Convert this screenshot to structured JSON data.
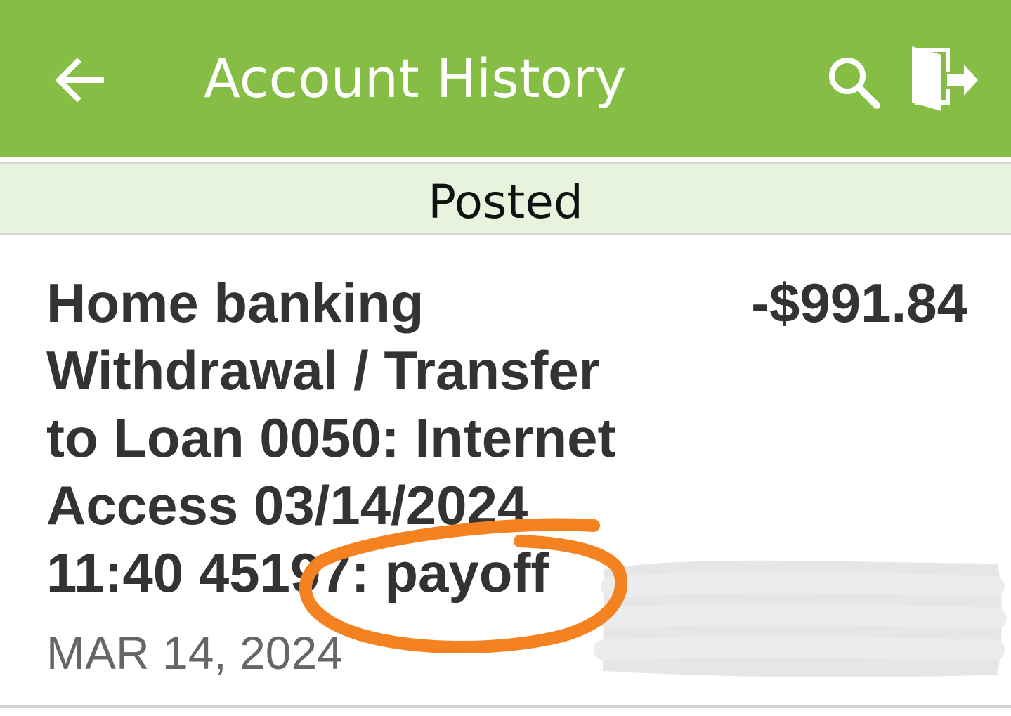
{
  "header": {
    "title": "Account History",
    "back_icon": "arrow-left-icon",
    "search_icon": "search-icon",
    "logout_icon": "exit-door-icon",
    "background_color": "#86bd45"
  },
  "section": {
    "label": "Posted",
    "background_color": "#e8f3de"
  },
  "transactions": [
    {
      "description": "Home banking Withdrawal / Transfer to Loan 0050: Internet Access 03/14/2024 11:40 45197: payoff",
      "amount": "-$991.84",
      "date": "MAR 14, 2024"
    }
  ],
  "annotations": {
    "circle_color": "#f58220",
    "redaction_color": "#e6e6e6"
  }
}
